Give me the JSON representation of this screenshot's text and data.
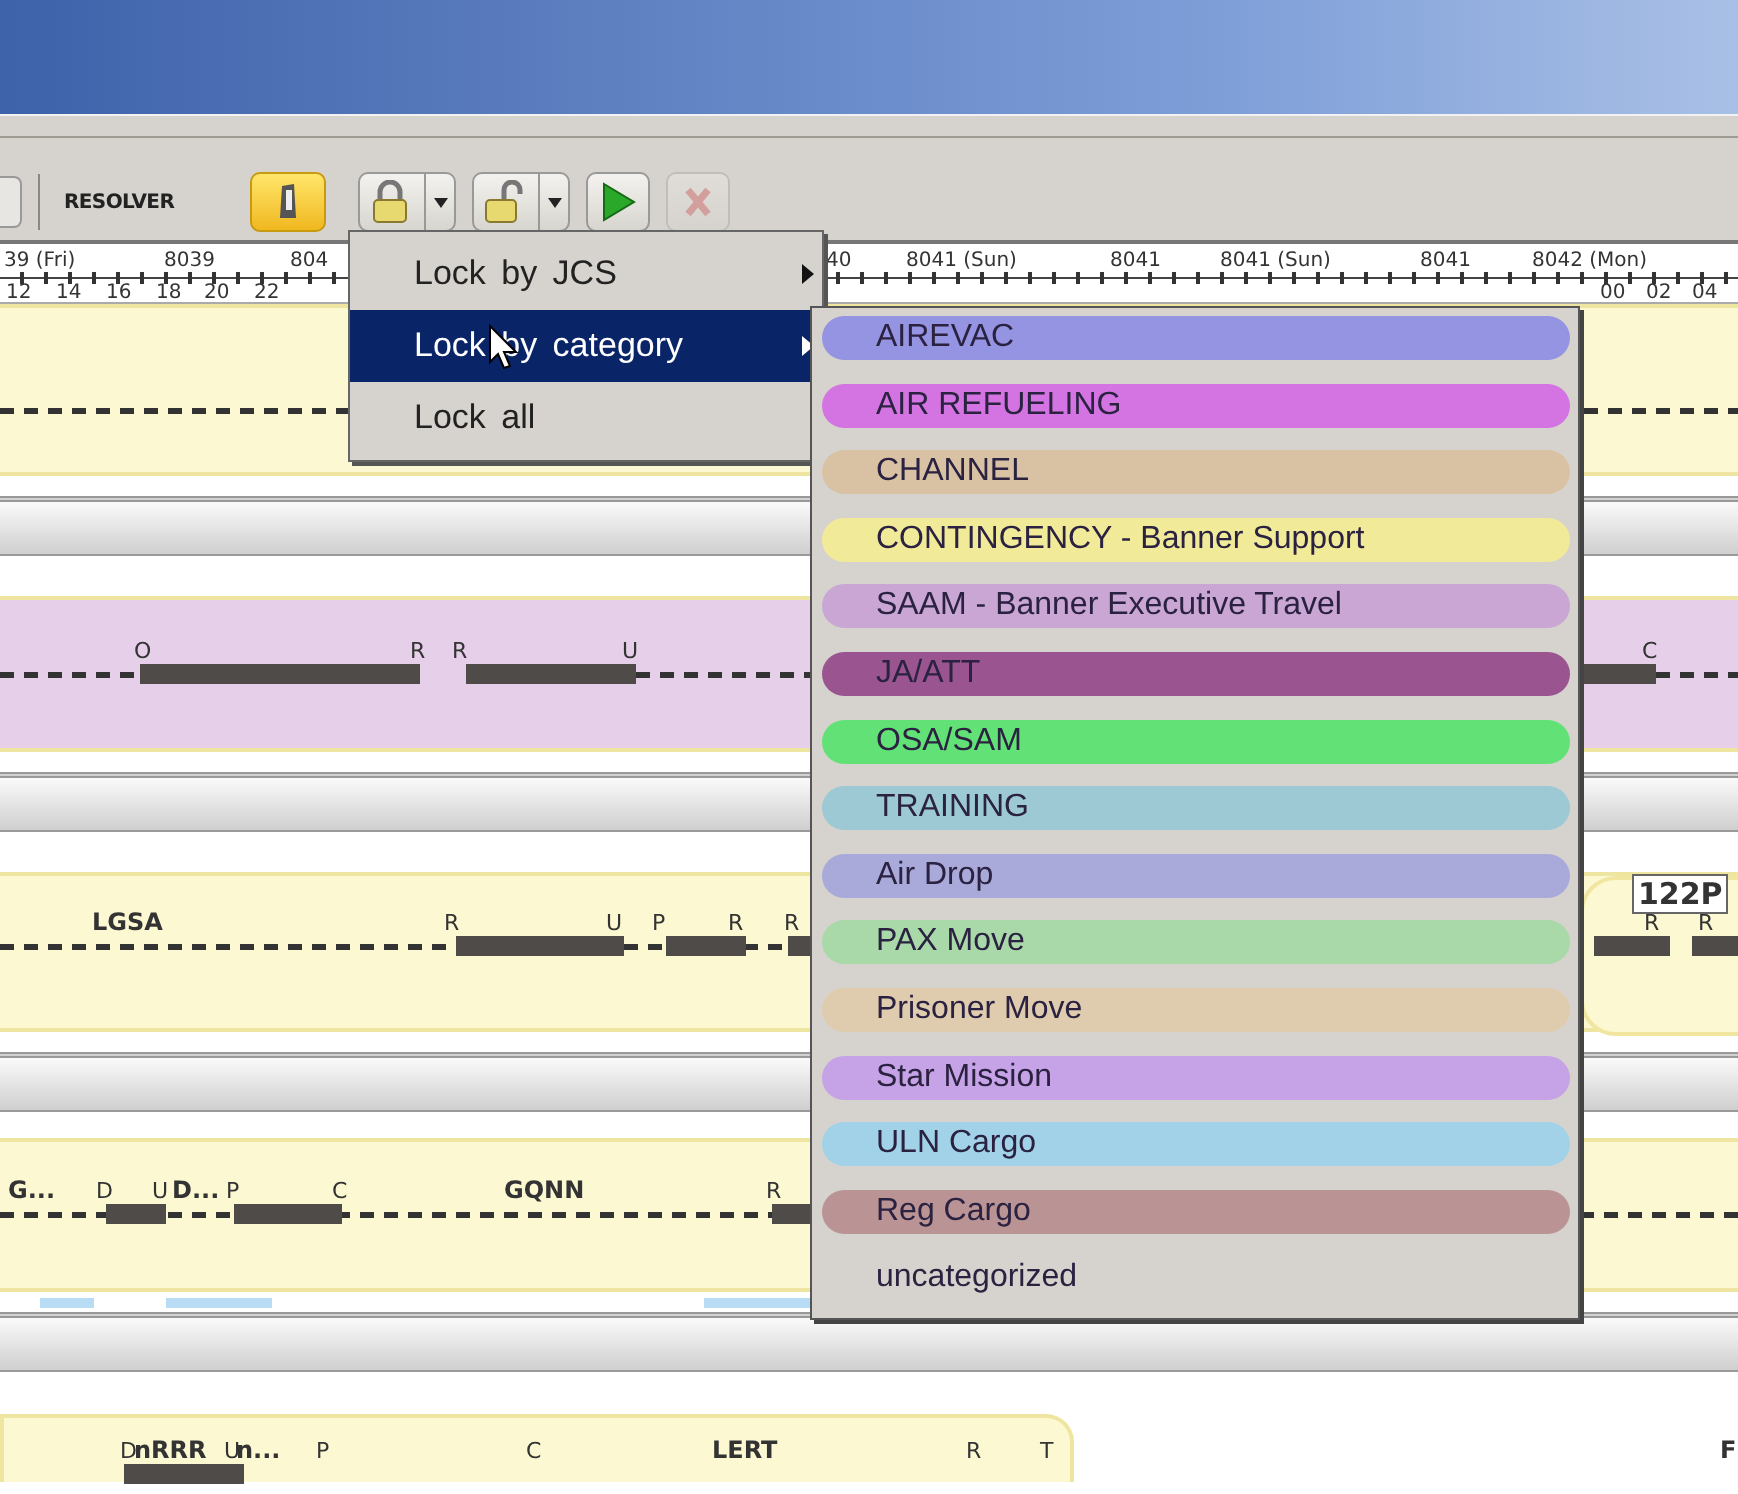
{
  "toolbar": {
    "label": "RESOLVER",
    "buttons": [
      {
        "kind": "phone",
        "disabled": false
      },
      {
        "kind": "lock",
        "disabled": false
      },
      {
        "kind": "unlock",
        "disabled": false
      },
      {
        "kind": "play",
        "disabled": false
      },
      {
        "kind": "stop",
        "disabled": true
      }
    ]
  },
  "ruler": {
    "dates": [
      "39 (Fri)",
      "8039",
      "804",
      "40",
      "8041 (Sun)",
      "8041",
      "8041 (Sun)",
      "8041",
      "8042 (Mon)"
    ],
    "hours": [
      "12",
      "14",
      "16",
      "18",
      "20",
      "22",
      "00",
      "02",
      "04"
    ]
  },
  "lanes": [
    {
      "color": "#fcf9d2"
    },
    {
      "color": "#e6cfe9",
      "markers": [
        {
          "kind": "event",
          "text": "O"
        },
        {
          "kind": "event",
          "text": "R"
        },
        {
          "kind": "event",
          "text": "R"
        },
        {
          "kind": "event",
          "text": "U"
        },
        {
          "kind": "event",
          "text": "C"
        }
      ]
    },
    {
      "color": "#fcf9d2",
      "markers": [
        {
          "kind": "site",
          "text": "LGSA"
        },
        {
          "kind": "event",
          "text": "R"
        },
        {
          "kind": "event",
          "text": "U"
        },
        {
          "kind": "event",
          "text": "P"
        },
        {
          "kind": "event",
          "text": "R"
        },
        {
          "kind": "event",
          "text": "R"
        },
        {
          "kind": "tail",
          "text": "122P"
        },
        {
          "kind": "event",
          "text": "R"
        },
        {
          "kind": "event",
          "text": "R"
        }
      ]
    },
    {
      "color": "#fcf9d2",
      "markers": [
        {
          "kind": "site",
          "text": "G..."
        },
        {
          "kind": "event",
          "text": "D"
        },
        {
          "kind": "event",
          "text": "U"
        },
        {
          "kind": "site",
          "text": "D..."
        },
        {
          "kind": "event",
          "text": "P"
        },
        {
          "kind": "event",
          "text": "C"
        },
        {
          "kind": "site",
          "text": "GQNN"
        },
        {
          "kind": "event",
          "text": "R"
        }
      ]
    },
    {
      "color": "#fcf9d2",
      "markers": [
        {
          "kind": "event",
          "text": "D"
        },
        {
          "kind": "site",
          "text": "nRRR"
        },
        {
          "kind": "event",
          "text": "U"
        },
        {
          "kind": "site",
          "text": "n..."
        },
        {
          "kind": "event",
          "text": "P"
        },
        {
          "kind": "event",
          "text": "C"
        },
        {
          "kind": "site",
          "text": "LERT"
        },
        {
          "kind": "event",
          "text": "R"
        },
        {
          "kind": "event",
          "text": "T"
        },
        {
          "kind": "site",
          "text": "F"
        }
      ]
    }
  ],
  "menu": {
    "items": [
      {
        "label": "Lock by JCS",
        "selected": false
      },
      {
        "label": "Lock by category",
        "selected": true
      },
      {
        "label": "Lock all",
        "selected": false
      }
    ]
  },
  "submenu": {
    "items": [
      {
        "label": "AIREVAC",
        "color": "#9494e2"
      },
      {
        "label": "AIR REFUELING",
        "color": "#d474e2"
      },
      {
        "label": "CHANNEL",
        "color": "#d9c2a4"
      },
      {
        "label": "CONTINGENCY - Banner Support",
        "color": "#f1ea98"
      },
      {
        "label": "SAAM - Banner Executive Travel",
        "color": "#c9a6d3"
      },
      {
        "label": "JA/ATT",
        "color": "#9a5490"
      },
      {
        "label": "OSA/SAM",
        "color": "#62e276"
      },
      {
        "label": "TRAINING",
        "color": "#9cc9d3"
      },
      {
        "label": "Air Drop",
        "color": "#aaaada"
      },
      {
        "label": "PAX Move",
        "color": "#a9d8a9"
      },
      {
        "label": "Prisoner Move",
        "color": "#dfcbad"
      },
      {
        "label": "Star Mission",
        "color": "#c6a2e6"
      },
      {
        "label": "ULN Cargo",
        "color": "#a2d2e8"
      },
      {
        "label": "Reg Cargo",
        "color": "#ba9494"
      },
      {
        "label": "uncategorized"
      }
    ]
  }
}
